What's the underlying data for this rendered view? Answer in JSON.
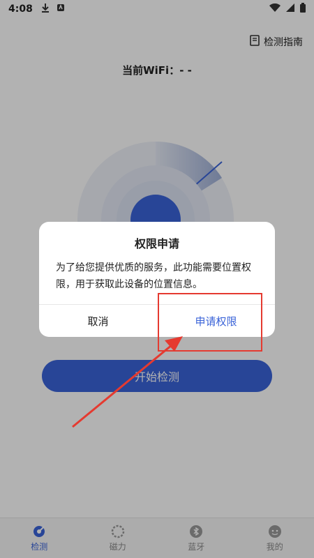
{
  "status_bar": {
    "time": "4:08"
  },
  "header": {
    "guide_label": "检测指南",
    "wifi_label": "当前WiFi：- -"
  },
  "main": {
    "start_button_label": "开始检测"
  },
  "dialog": {
    "title": "权限申请",
    "message": "为了给您提供优质的服务，此功能需要位置权限，用于获取此设备的位置信息。",
    "cancel_label": "取消",
    "confirm_label": "申请权限"
  },
  "bottom_nav": {
    "items": [
      {
        "label": "检测",
        "icon": "detect-icon"
      },
      {
        "label": "磁力",
        "icon": "magnet-icon"
      },
      {
        "label": "蓝牙",
        "icon": "bluetooth-icon"
      },
      {
        "label": "我的",
        "icon": "profile-icon"
      }
    ],
    "active_index": 0
  },
  "colors": {
    "accent": "#3a63d8",
    "annotation": "#e53a30"
  }
}
